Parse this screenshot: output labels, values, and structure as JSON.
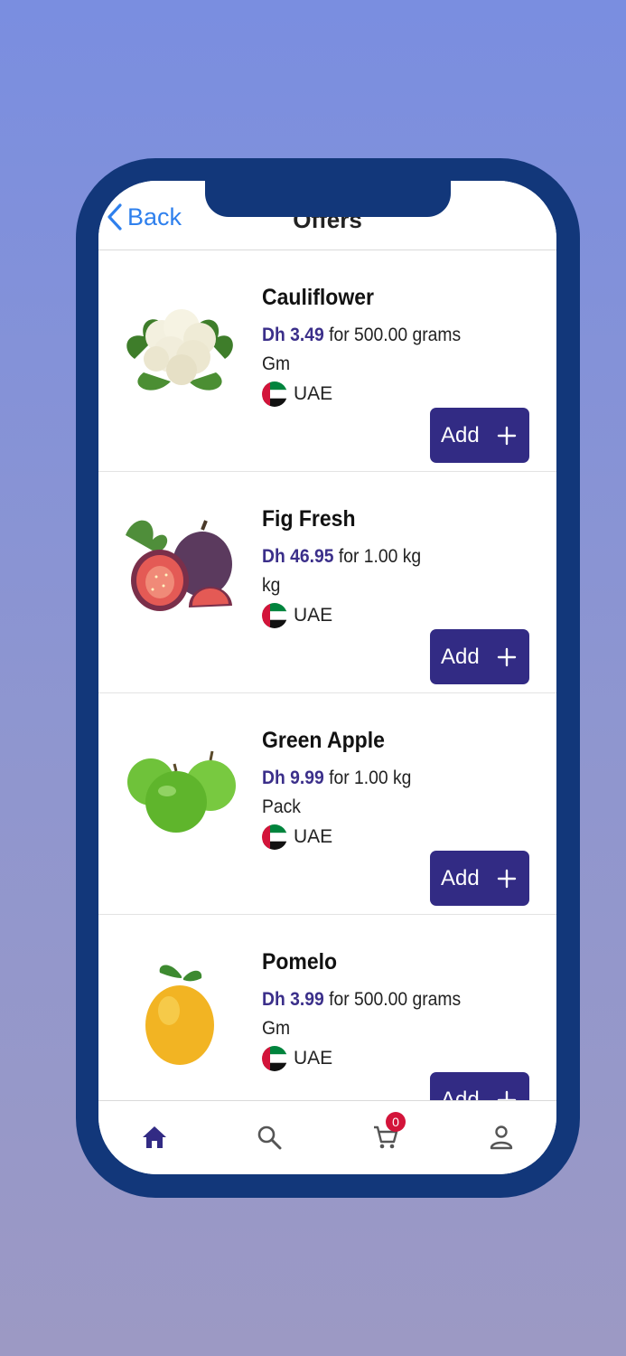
{
  "header": {
    "back_label": "Back",
    "title": "Offers"
  },
  "products": [
    {
      "name": "Cauliflower",
      "price": "Dh 3.49",
      "qty": "for 500.00 grams",
      "unit": "Gm",
      "origin": "UAE",
      "add_label": "Add"
    },
    {
      "name": "Fig Fresh",
      "price": "Dh 46.95",
      "qty": "for 1.00 kg",
      "unit": "kg",
      "origin": "UAE",
      "add_label": "Add"
    },
    {
      "name": "Green Apple",
      "price": "Dh 9.99",
      "qty": "for 1.00 kg",
      "unit": "Pack",
      "origin": "UAE",
      "add_label": "Add"
    },
    {
      "name": "Pomelo",
      "price": "Dh 3.99",
      "qty": "for 500.00 grams",
      "unit": "Gm",
      "origin": "UAE",
      "add_label": "Add"
    }
  ],
  "tabbar": {
    "items": [
      {
        "icon": "home-icon",
        "active": true
      },
      {
        "icon": "search-icon",
        "active": false
      },
      {
        "icon": "cart-icon",
        "active": false
      },
      {
        "icon": "profile-icon",
        "active": false
      }
    ],
    "cart_count": "0"
  },
  "colors": {
    "accent": "#322b84",
    "price": "#3b2f8a",
    "back_link": "#2f80ed",
    "phone_frame": "#12377a",
    "badge": "#d3143a"
  }
}
